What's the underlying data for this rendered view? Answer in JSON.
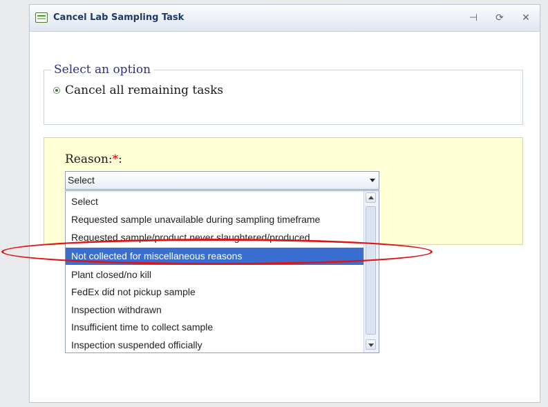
{
  "window": {
    "title": "Cancel Lab Sampling Task",
    "controls": [
      {
        "name": "pin-icon",
        "glyph": "⊣"
      },
      {
        "name": "refresh-icon",
        "glyph": "⟳"
      },
      {
        "name": "close-icon",
        "glyph": "✕"
      }
    ]
  },
  "option_group": {
    "legend": "Select an option",
    "radio": {
      "label": "Cancel all remaining tasks",
      "checked": true
    }
  },
  "reason": {
    "label": "Reason:",
    "required_mark": "*",
    "label_suffix": ":",
    "select_value": "Select",
    "options": [
      "Select",
      "Requested sample unavailable during sampling timeframe",
      "Requested sample/product never slaughtered/produced",
      "Not collected for miscellaneous reasons",
      "Plant closed/no kill",
      "FedEx did not pickup sample",
      "Inspection withdrawn",
      "Insufficient time to collect sample",
      "Inspection suspended officially"
    ],
    "highlighted_index": 3
  },
  "colors": {
    "highlight": "#3a6fd1",
    "annotation": "#e01414",
    "reason_panel_bg": "#ffffd6",
    "legend_text": "#2a2f8a"
  }
}
